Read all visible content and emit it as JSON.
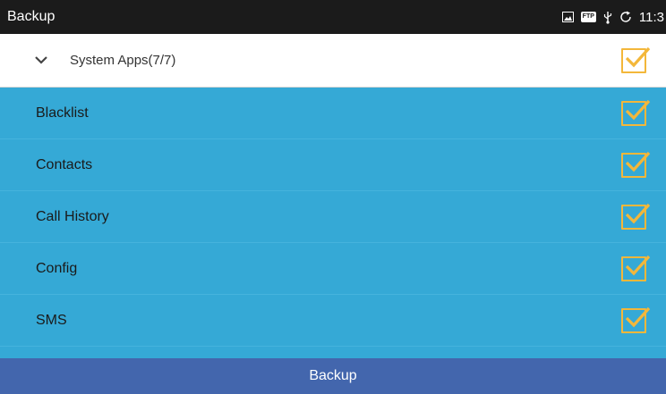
{
  "status_bar": {
    "title": "Backup",
    "ftp_badge": "FTP",
    "time": "11:3",
    "icons": [
      "gallery-icon",
      "ftp-icon",
      "usb-icon",
      "sync-icon"
    ]
  },
  "group": {
    "label": "System Apps(7/7)",
    "checked": true,
    "expanded": true
  },
  "items": [
    {
      "label": "Blacklist",
      "checked": true
    },
    {
      "label": "Contacts",
      "checked": true
    },
    {
      "label": "Call History",
      "checked": true
    },
    {
      "label": "Config",
      "checked": true
    },
    {
      "label": "SMS",
      "checked": true
    }
  ],
  "footer": {
    "button_label": "Backup"
  },
  "colors": {
    "status_bar": "#1b1b1b",
    "list_background": "#35a9d6",
    "checkbox": "#f3b73a",
    "footer_button": "#4366ad"
  }
}
